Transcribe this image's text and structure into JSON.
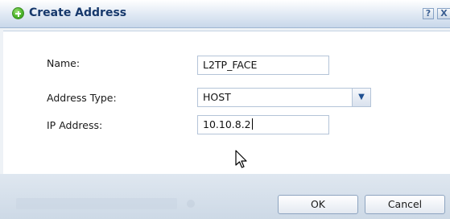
{
  "dialog": {
    "title": "Create Address",
    "help_label": "?",
    "close_label": "X"
  },
  "form": {
    "name_label": "Name:",
    "name_value": "L2TP_FACE",
    "type_label": "Address Type:",
    "type_value": "HOST",
    "ip_label": "IP Address:",
    "ip_value": "10.10.8.2"
  },
  "buttons": {
    "ok": "OK",
    "cancel": "Cancel"
  }
}
